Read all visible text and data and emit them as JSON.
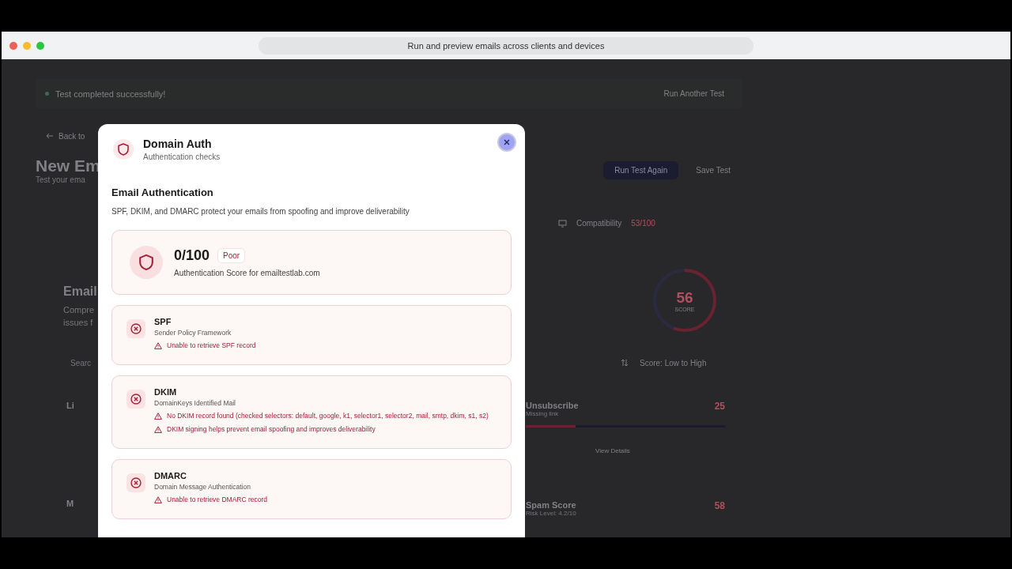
{
  "browser": {
    "url_text": "Run and preview emails across clients and devices"
  },
  "background": {
    "banner": {
      "message": "Test completed successfully!",
      "action": "Run Another Test"
    },
    "back_link": "Back to",
    "title": "New Em",
    "subtitle": "Test your ema",
    "buttons": [
      {
        "label": "Run Test Again",
        "kind": "primary"
      },
      {
        "label": "Save Test",
        "kind": "secondary"
      }
    ],
    "compatibility": {
      "label": "Compatibility",
      "value": "53/100"
    },
    "section": {
      "title": "Email",
      "description_lines": [
        "Compre",
        "issues f"
      ]
    },
    "score": {
      "value": "56",
      "label": "SCORE",
      "level": 0.56
    },
    "search": {
      "placeholder": "Searc"
    },
    "sort": "Score: Low to High",
    "left_cards": [
      {
        "title": "Li"
      },
      {
        "title": "M"
      }
    ],
    "right_cards": [
      {
        "title": "Unsubscribe",
        "detail": "Missing link",
        "score": "25",
        "level": 0.25,
        "action": "View Details"
      },
      {
        "title": "Spam Score",
        "detail": "Risk Level: 4.2/10",
        "score": "58"
      }
    ]
  },
  "modal": {
    "title": "Domain Auth",
    "subtitle": "Authentication checks",
    "section_title": "Email Authentication",
    "section_description": "SPF, DKIM, and DMARC protect your emails from spoofing and improve deliverability",
    "score": {
      "value": "0/100",
      "rating": "Poor",
      "caption": "Authentication Score for emailtestlab.com"
    },
    "checks": [
      {
        "name": "SPF",
        "description": "Sender Policy Framework",
        "passed": false,
        "messages": [
          "Unable to retrieve SPF record"
        ]
      },
      {
        "name": "DKIM",
        "description": "DomainKeys Identified Mail",
        "passed": false,
        "messages": [
          "No DKIM record found (checked selectors: default, google, k1, selector1, selector2, mail, smtp, dkim, s1, s2)",
          "DKIM signing helps prevent email spoofing and improves deliverability"
        ]
      },
      {
        "name": "DMARC",
        "description": "Domain Message Authentication",
        "passed": false,
        "messages": [
          "Unable to retrieve DMARC record"
        ]
      }
    ]
  }
}
